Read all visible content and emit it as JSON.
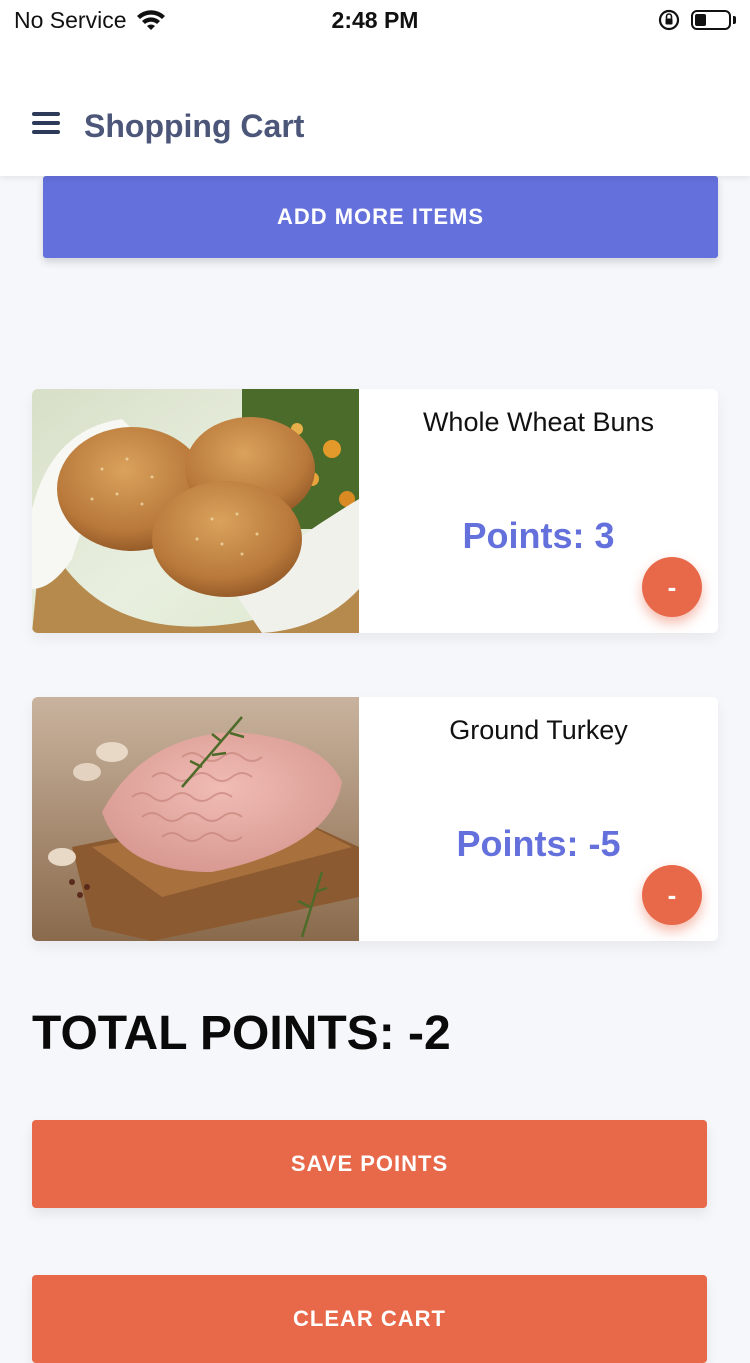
{
  "status_bar": {
    "carrier": "No Service",
    "time": "2:48 PM",
    "battery_level": 0.35
  },
  "header": {
    "title": "Shopping Cart",
    "menu_icon": "hamburger-menu-icon"
  },
  "add_more_label": "ADD MORE ITEMS",
  "cart": {
    "items": [
      {
        "name": "Whole Wheat Buns",
        "points": "Points: 3",
        "image": "buns-photo",
        "remove_label": "-"
      },
      {
        "name": "Ground Turkey",
        "points": "Points: -5",
        "image": "ground-turkey-photo",
        "remove_label": "-"
      }
    ]
  },
  "total": "TOTAL POINTS: -2",
  "buttons": {
    "save": "SAVE POINTS",
    "clear": "CLEAR CART"
  },
  "colors": {
    "primary": "#6470dc",
    "accent": "#e8694a",
    "header_title": "#4b5679",
    "background": "#f6f7fb"
  }
}
